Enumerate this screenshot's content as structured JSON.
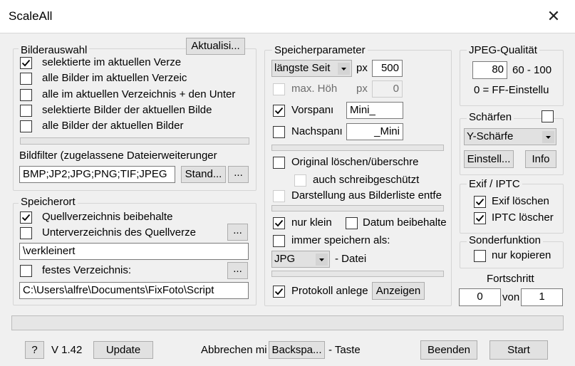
{
  "window": {
    "title": "ScaleAll",
    "close_glyph": "✕"
  },
  "selection": {
    "group_label": "Bilderauswahl",
    "refresh_button": "Aktualisi...",
    "options": [
      {
        "label": "selektierte im aktuellen Verze",
        "checked": true
      },
      {
        "label": "alle Bilder im aktuellen Verzeic",
        "checked": false
      },
      {
        "label": "alle im aktuellen Verzeichnis +  den Unter",
        "checked": false
      },
      {
        "label": "selektierte Bilder der aktuellen Bilde",
        "checked": false
      },
      {
        "label": "alle Bilder der aktuellen Bilder",
        "checked": false
      }
    ],
    "progress": 0,
    "filter_label": "Bildfilter (zugelassene Dateierweiterunger",
    "filter_value": "BMP;JP2;JPG;PNG;TIF;JPEG",
    "standard_button": "Stand...",
    "more_button": "..."
  },
  "storage_location": {
    "group_label": "Speicherort",
    "keep_source": {
      "label": "Quellverzeichnis beibehalte",
      "checked": true
    },
    "subfolder": {
      "label": "Unterverzeichnis des Quellverze",
      "checked": false,
      "button": "..."
    },
    "subfolder_value": "\\verkleinert",
    "fixed": {
      "label": "festes Verzeichnis:",
      "checked": false,
      "button": "..."
    },
    "fixed_value": "C:\\Users\\alfre\\Documents\\FixFoto\\Script"
  },
  "save_params": {
    "group_label": "Speicherparameter",
    "side_select": "längste Seit",
    "px_label": "px",
    "px_value": "500",
    "max_height": {
      "label": "max. Höh",
      "checked": false,
      "px_label": "px",
      "value": "0"
    },
    "prefix": {
      "label": "Vorspanı",
      "checked": true,
      "value": "Mini_"
    },
    "suffix": {
      "label": "Nachspanı",
      "checked": false,
      "value": "_Mini"
    },
    "progress1": 0,
    "delete_original": {
      "label": "Original löschen/überschre",
      "checked": false
    },
    "write_protected": {
      "label": "auch schreibgeschützt",
      "checked": false
    },
    "list_display": {
      "label": "Darstellung aus Bilderliste entfe",
      "checked": false
    },
    "progress2": 0,
    "only_small": {
      "label": "nur klein",
      "checked": true
    },
    "keep_date": {
      "label": "Datum beibehalte",
      "checked": false
    },
    "always_save": {
      "label": "immer speichern als:",
      "checked": false
    },
    "format_select": "JPG",
    "format_suffix": "- Datei",
    "progress3": 0,
    "log": {
      "label": "Protokoll anlege",
      "checked": true,
      "button": "Anzeigen"
    }
  },
  "jpeg": {
    "group_label": "JPEG-Qualität",
    "value": "80",
    "range": "60 - 100",
    "note": "0 = FF-Einstellu"
  },
  "sharpen": {
    "group_label": "Schärfen",
    "checked": false,
    "select": "Y-Schärfe",
    "settings_button": "Einstell...",
    "info_button": "Info"
  },
  "exif": {
    "group_label": "Exif / IPTC",
    "exif_delete": {
      "label": "Exif löschen",
      "checked": true
    },
    "iptc_delete": {
      "label": "IPTC löscher",
      "checked": true
    }
  },
  "special": {
    "group_label": "Sonderfunktion",
    "copy_only": {
      "label": "nur kopieren",
      "checked": false
    }
  },
  "progress_counter": {
    "label": "Fortschritt",
    "current": "0",
    "of": "von",
    "total": "1"
  },
  "overall_progress": 0,
  "footer": {
    "help_button": "?",
    "version": "V 1.42",
    "update_button": "Update",
    "cancel_prefix": "Abbrechen mi",
    "cancel_key_button": "Backspa...",
    "cancel_suffix": "- Taste",
    "quit_button": "Beenden",
    "start_button": "Start"
  },
  "colors": {
    "window_bg": "#f0f0f0",
    "title_bg": "#ffffff",
    "button_bg": "#e1e1e1",
    "border": "#adadad"
  }
}
